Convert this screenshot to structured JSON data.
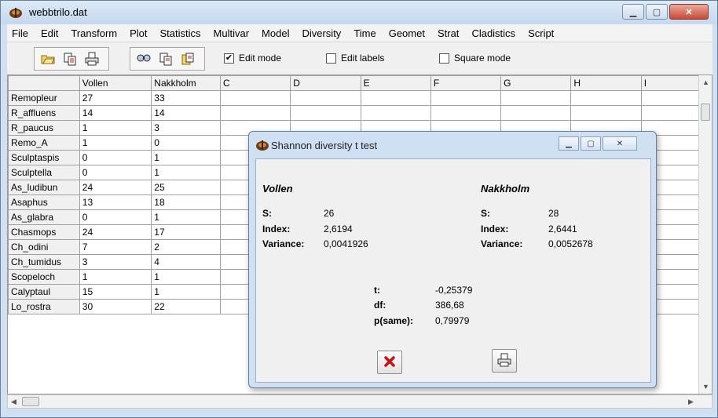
{
  "window": {
    "title": "webbtrilo.dat"
  },
  "menu": [
    "File",
    "Edit",
    "Transform",
    "Plot",
    "Statistics",
    "Multivar",
    "Model",
    "Diversity",
    "Time",
    "Geomet",
    "Strat",
    "Cladistics",
    "Script"
  ],
  "toolbar": {
    "edit_mode": {
      "label": "Edit mode",
      "checked": true
    },
    "edit_labels": {
      "label": "Edit labels",
      "checked": false
    },
    "square_mode": {
      "label": "Square mode",
      "checked": false
    }
  },
  "grid": {
    "columns": [
      "Vollen",
      "Nakkholm",
      "C",
      "D",
      "E",
      "F",
      "G",
      "H",
      "I"
    ],
    "rows": [
      {
        "name": "Remopleur",
        "v": "27",
        "n": "33"
      },
      {
        "name": "R_affluens",
        "v": "14",
        "n": "14"
      },
      {
        "name": "R_paucus",
        "v": "1",
        "n": "3"
      },
      {
        "name": "Remo_A",
        "v": "1",
        "n": "0"
      },
      {
        "name": "Sculptaspis",
        "v": "0",
        "n": "1"
      },
      {
        "name": "Sculptella",
        "v": "0",
        "n": "1"
      },
      {
        "name": "As_ludibun",
        "v": "24",
        "n": "25"
      },
      {
        "name": "Asaphus",
        "v": "13",
        "n": "18"
      },
      {
        "name": "As_glabra",
        "v": "0",
        "n": "1"
      },
      {
        "name": "Chasmops",
        "v": "24",
        "n": "17"
      },
      {
        "name": "Ch_odini",
        "v": "7",
        "n": "2"
      },
      {
        "name": "Ch_tumidus",
        "v": "3",
        "n": "4"
      },
      {
        "name": "Scopeloch",
        "v": "1",
        "n": "1"
      },
      {
        "name": "Calyptaul",
        "v": "15",
        "n": "1"
      },
      {
        "name": "Lo_rostra",
        "v": "30",
        "n": "22"
      }
    ]
  },
  "dialog": {
    "title": "Shannon diversity t test",
    "left": {
      "name": "Vollen",
      "s_label": "S:",
      "s": "26",
      "index_label": "Index:",
      "index": "2,6194",
      "variance_label": "Variance:",
      "variance": "0,0041926"
    },
    "right": {
      "name": "Nakkholm",
      "s_label": "S:",
      "s": "28",
      "index_label": "Index:",
      "index": "2,6441",
      "variance_label": "Variance:",
      "variance": "0,0052678"
    },
    "t_label": "t:",
    "t": "-0,25379",
    "df_label": "df:",
    "df": "386,68",
    "p_label": "p(same):",
    "p": "0,79979"
  },
  "colors": {
    "accent": "#cfe0f3",
    "close": "#c74a36",
    "cancel_x": "#cc1111"
  }
}
